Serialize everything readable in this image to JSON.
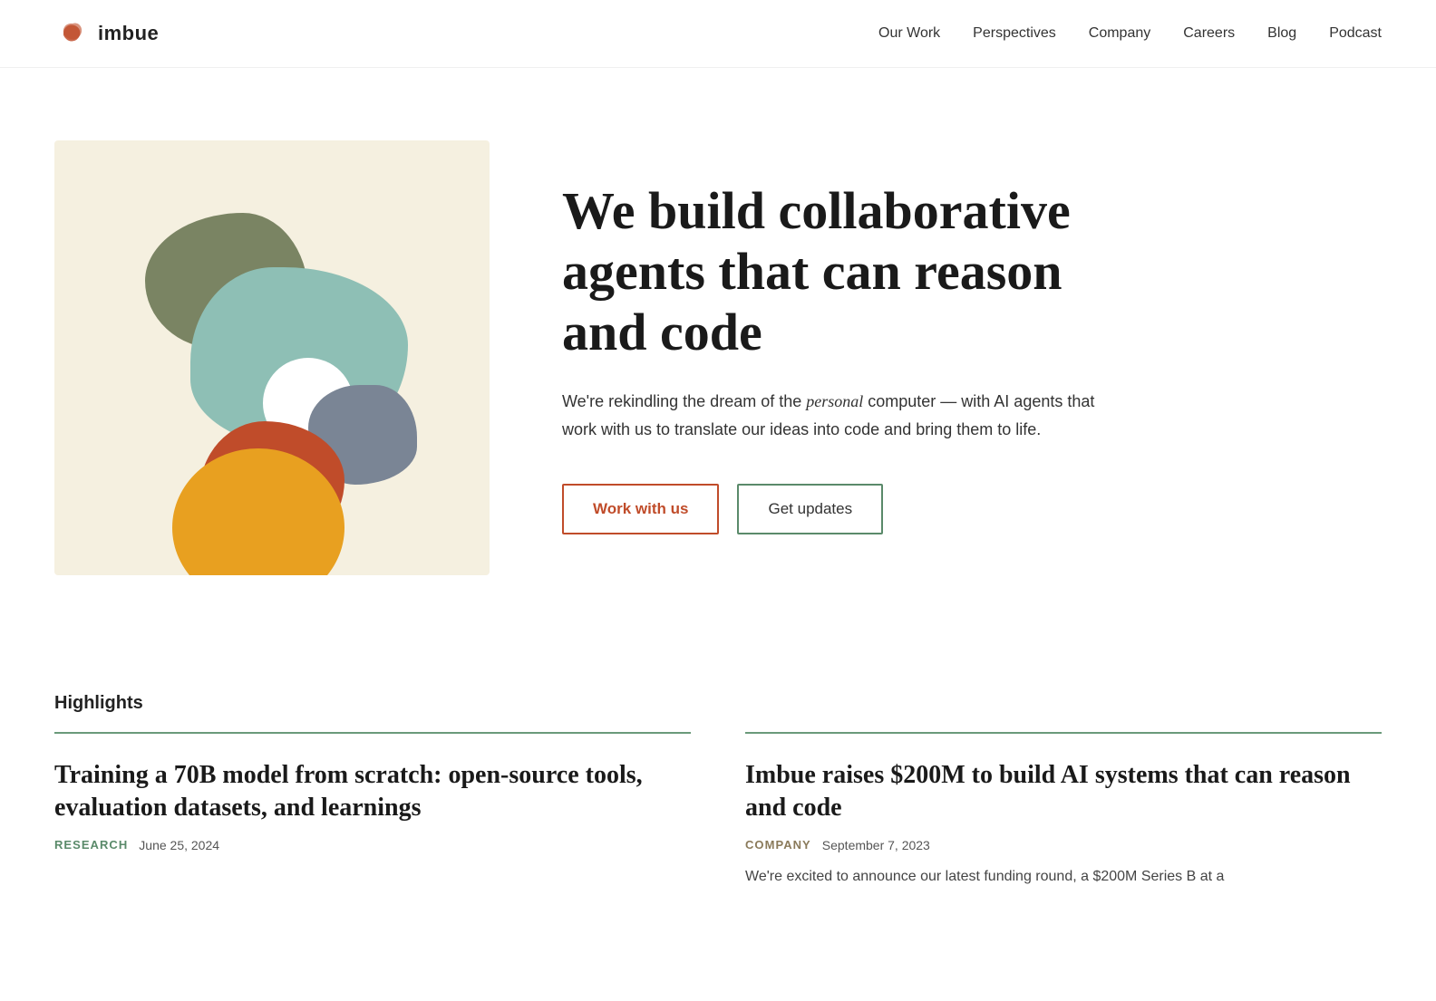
{
  "nav": {
    "logo_text": "imbue",
    "links": [
      {
        "label": "Our Work",
        "href": "#"
      },
      {
        "label": "Perspectives",
        "href": "#"
      },
      {
        "label": "Company",
        "href": "#"
      },
      {
        "label": "Careers",
        "href": "#"
      },
      {
        "label": "Blog",
        "href": "#"
      },
      {
        "label": "Podcast",
        "href": "#"
      }
    ]
  },
  "hero": {
    "heading": "We build collaborative agents that can reason and code",
    "description_part1": "We're rekindling the dream of the ",
    "description_italic": "personal",
    "description_part2": " computer — with AI agents that work with us to translate our ideas into code and bring them to life.",
    "btn_work": "Work with us",
    "btn_updates": "Get updates"
  },
  "highlights": {
    "section_title": "Highlights",
    "items": [
      {
        "heading": "Training a 70B model from scratch: open-source tools, evaluation datasets, and learnings",
        "category": "RESEARCH",
        "date": "June 25, 2024",
        "category_class": "cat-research"
      },
      {
        "heading": "Imbue raises $200M to build AI systems that can reason and code",
        "category": "COMPANY",
        "date": "September 7, 2023",
        "excerpt": "We're excited to announce our latest funding round, a $200M Series B at a",
        "category_class": "cat-company"
      }
    ]
  }
}
